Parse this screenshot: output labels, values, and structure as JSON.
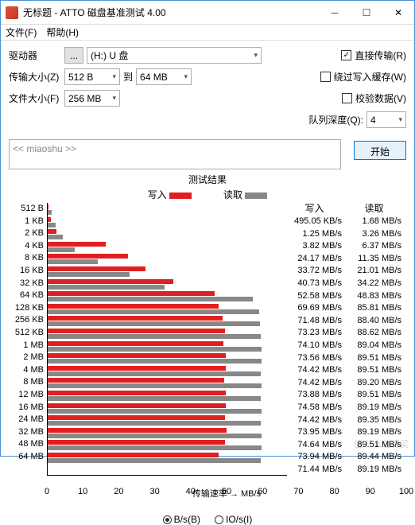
{
  "window": {
    "title": "无标题 - ATTO 磁盘基准测试 4.00"
  },
  "menu": {
    "file": "文件(F)",
    "help": "帮助(H)"
  },
  "controls": {
    "drive_label": "驱动器",
    "drive_value": "(H:) U 盘",
    "transfer_size_label": "传输大小(Z)",
    "transfer_from": "512 B",
    "transfer_to_label": "到",
    "transfer_to": "64 MB",
    "file_size_label": "文件大小(F)",
    "file_size": "256 MB",
    "direct_transfer": "直接传输(R)",
    "bypass_cache": "绕过写入缓存(W)",
    "verify_data": "校验数据(V)",
    "queue_depth_label": "队列深度(Q):",
    "queue_depth": "4"
  },
  "desc": {
    "placeholder": "<< miaoshu >>"
  },
  "start_button": "开始",
  "results": {
    "title": "测试结果",
    "write_legend": "写入",
    "read_legend": "读取",
    "write_header": "写入",
    "read_header": "读取",
    "xlabel": "传输速率 → MB/s",
    "radio_bs": "B/s(B)",
    "radio_ios": "IO/s(I)"
  },
  "chart_data": {
    "type": "bar",
    "xlabel": "传输速率 → MB/s",
    "xlim": [
      0,
      100
    ],
    "xticks": [
      0,
      10,
      20,
      30,
      40,
      50,
      60,
      70,
      80,
      90,
      100
    ],
    "categories": [
      "512 B",
      "1 KB",
      "2 KB",
      "4 KB",
      "8 KB",
      "16 KB",
      "32 KB",
      "64 KB",
      "128 KB",
      "256 KB",
      "512 KB",
      "1 MB",
      "2 MB",
      "4 MB",
      "8 MB",
      "12 MB",
      "16 MB",
      "24 MB",
      "32 MB",
      "48 MB",
      "64 MB"
    ],
    "series": [
      {
        "name": "写入",
        "color": "#e02020",
        "unit": "KB/s|MB/s",
        "display": [
          "495.05 KB/s",
          "1.25 MB/s",
          "3.82 MB/s",
          "24.17 MB/s",
          "33.72 MB/s",
          "40.73 MB/s",
          "52.58 MB/s",
          "69.69 MB/s",
          "71.48 MB/s",
          "73.23 MB/s",
          "74.10 MB/s",
          "73.56 MB/s",
          "74.42 MB/s",
          "74.42 MB/s",
          "73.88 MB/s",
          "74.58 MB/s",
          "74.42 MB/s",
          "73.95 MB/s",
          "74.64 MB/s",
          "73.94 MB/s",
          "71.44 MB/s"
        ],
        "values_mb": [
          0.48,
          1.25,
          3.82,
          24.17,
          33.72,
          40.73,
          52.58,
          69.69,
          71.48,
          73.23,
          74.1,
          73.56,
          74.42,
          74.42,
          73.88,
          74.58,
          74.42,
          73.95,
          74.64,
          73.94,
          71.44
        ]
      },
      {
        "name": "读取",
        "color": "#888888",
        "unit": "MB/s",
        "display": [
          "1.68 MB/s",
          "3.26 MB/s",
          "6.37 MB/s",
          "11.35 MB/s",
          "21.01 MB/s",
          "34.22 MB/s",
          "48.83 MB/s",
          "85.81 MB/s",
          "88.40 MB/s",
          "88.62 MB/s",
          "89.04 MB/s",
          "89.51 MB/s",
          "89.51 MB/s",
          "89.20 MB/s",
          "89.51 MB/s",
          "89.19 MB/s",
          "89.35 MB/s",
          "89.19 MB/s",
          "89.51 MB/s",
          "89.44 MB/s",
          "89.19 MB/s"
        ],
        "values_mb": [
          1.68,
          3.26,
          6.37,
          11.35,
          21.01,
          34.22,
          48.83,
          85.81,
          88.4,
          88.62,
          89.04,
          89.51,
          89.51,
          89.2,
          89.51,
          89.19,
          89.35,
          89.19,
          89.51,
          89.44,
          89.19
        ]
      }
    ]
  },
  "watermark": "值 什么值得买"
}
